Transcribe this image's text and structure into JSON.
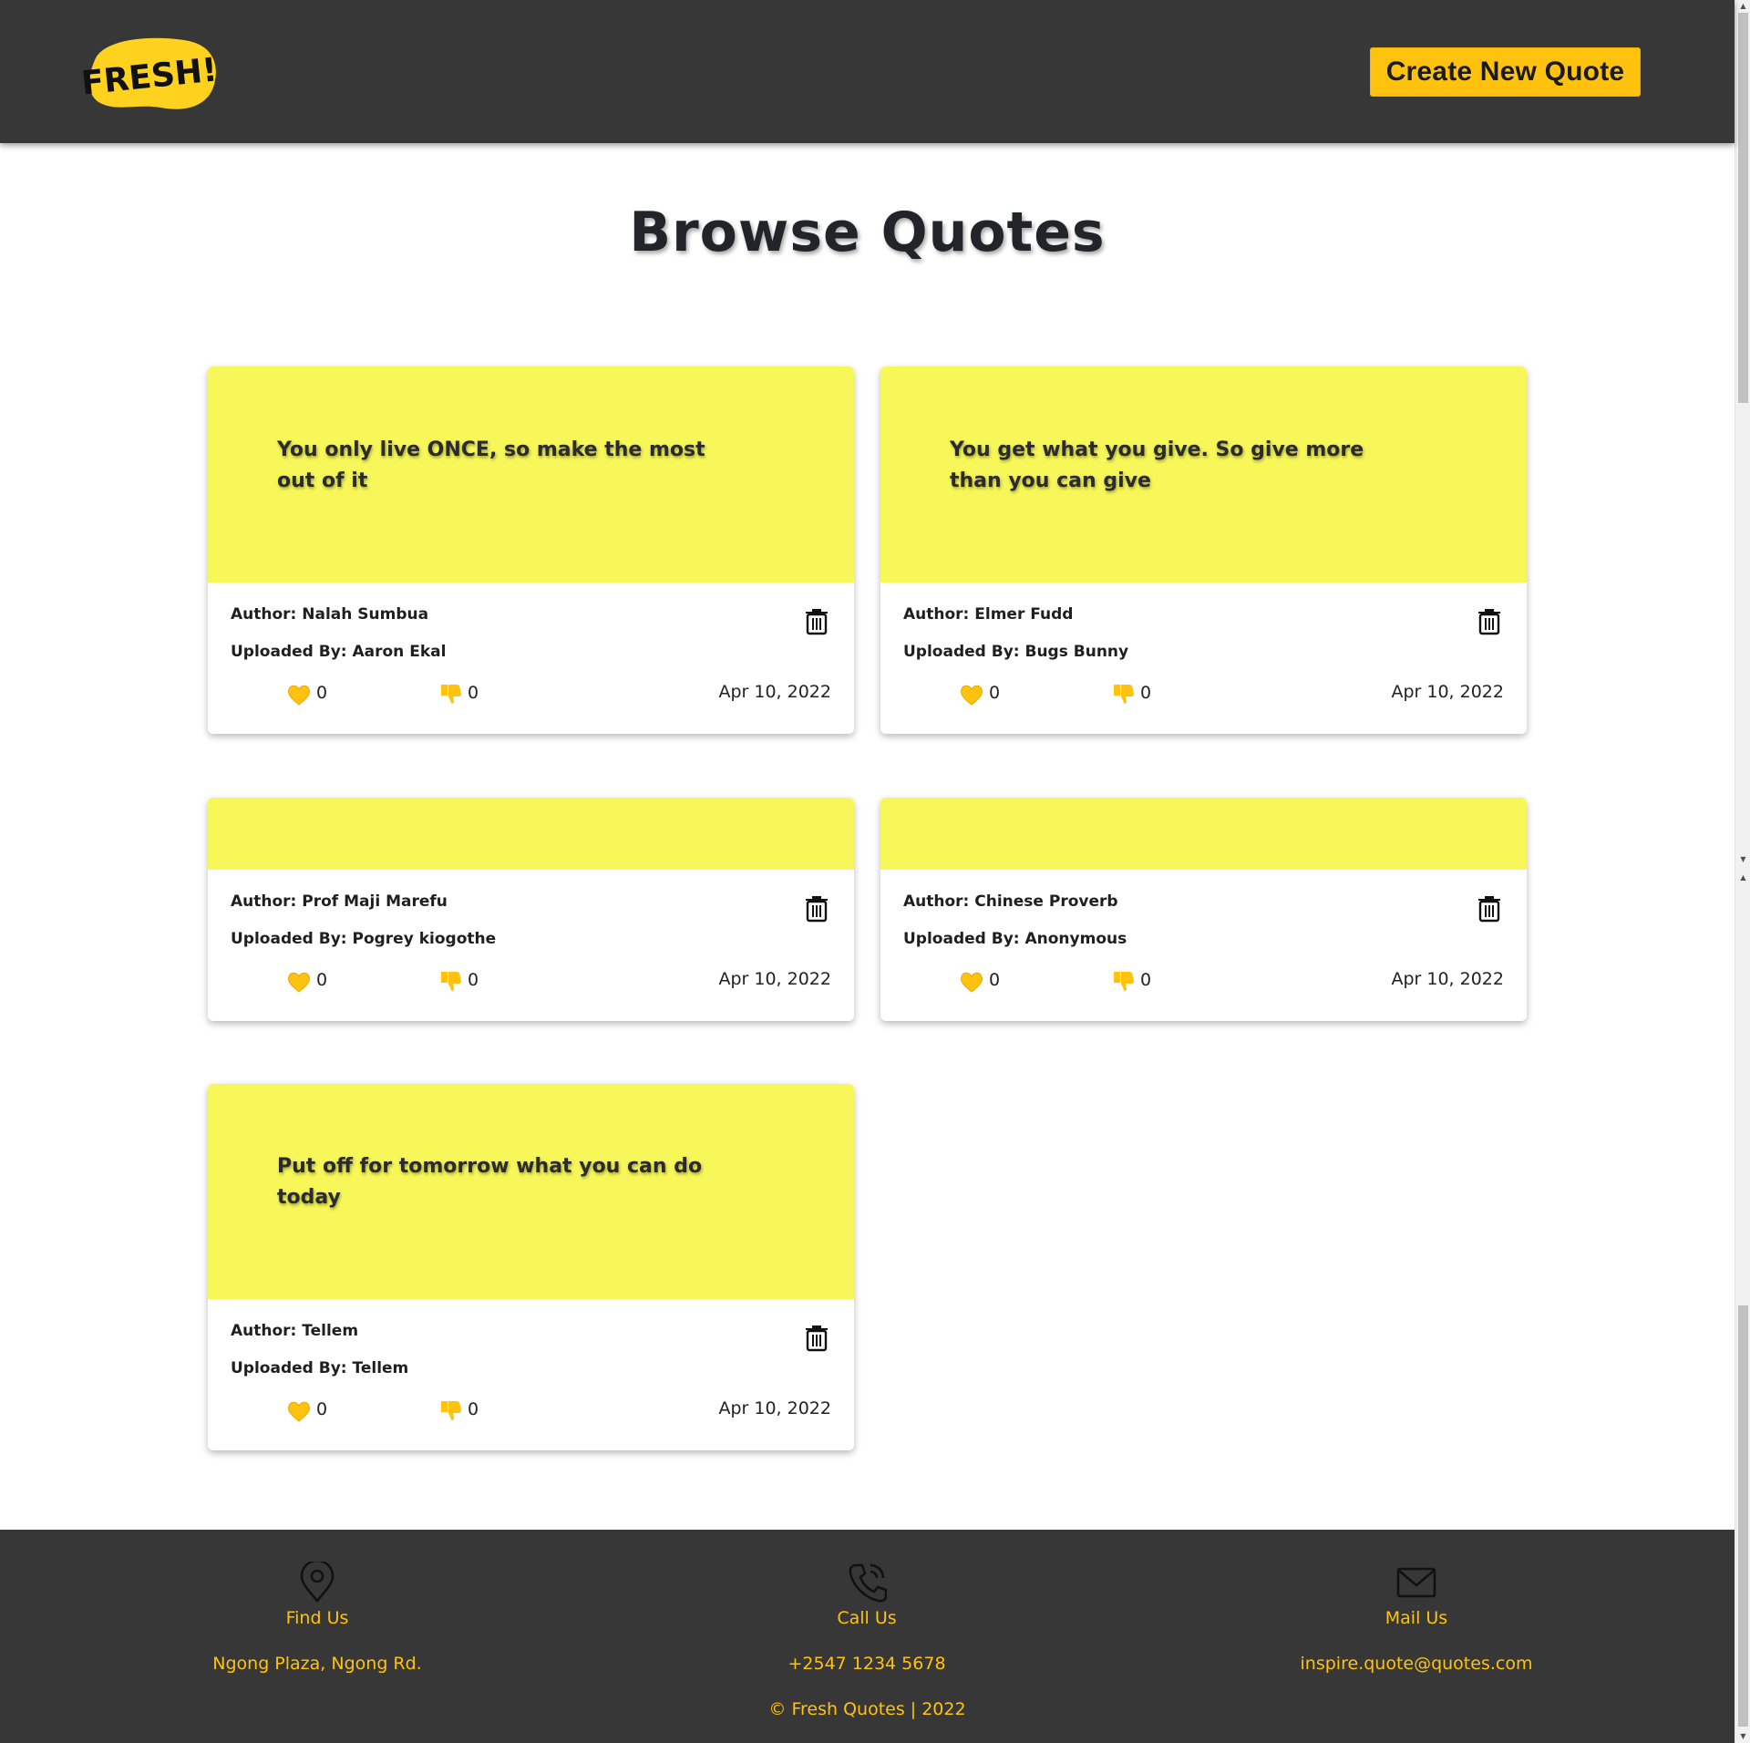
{
  "header": {
    "logo_text": "FRESH!",
    "create_button_label": "Create New Quote"
  },
  "page_title": "Browse Quotes",
  "quotes": [
    {
      "text": "You only live ONCE, so make the most out of it",
      "author": "Author: Nalah Sumbua",
      "uploaded_by": "Uploaded By: Aaron Ekal",
      "likes": "0",
      "dislikes": "0",
      "date": "Apr 10, 2022"
    },
    {
      "text": "You get what you give. So give more than you can give",
      "author": "Author: Elmer Fudd",
      "uploaded_by": "Uploaded By: Bugs Bunny",
      "likes": "0",
      "dislikes": "0",
      "date": "Apr 10, 2022"
    },
    {
      "text": "",
      "author": "Author: Prof Maji Marefu",
      "uploaded_by": "Uploaded By: Pogrey kiogothe",
      "likes": "0",
      "dislikes": "0",
      "date": "Apr 10, 2022"
    },
    {
      "text": "",
      "author": "Author: Chinese Proverb",
      "uploaded_by": "Uploaded By: Anonymous",
      "likes": "0",
      "dislikes": "0",
      "date": "Apr 10, 2022"
    },
    {
      "text": "Put off for tomorrow what you can do today",
      "author": "Author: Tellem",
      "uploaded_by": "Uploaded By: Tellem",
      "likes": "0",
      "dislikes": "0",
      "date": "Apr 10, 2022"
    }
  ],
  "footer": {
    "find": {
      "title": "Find Us",
      "value": "Ngong Plaza, Ngong Rd.",
      "icon": "map-pin-icon"
    },
    "call": {
      "title": "Call Us",
      "value": "+2547 1234 5678",
      "icon": "phone-icon"
    },
    "mail": {
      "title": "Mail Us",
      "value": "inspire.quote@quotes.com",
      "icon": "envelope-icon"
    },
    "copyright": "© Fresh Quotes | 2022"
  },
  "colors": {
    "navbar": "#373737",
    "accent": "#ffc20e",
    "card_top": "#f7f75a"
  }
}
